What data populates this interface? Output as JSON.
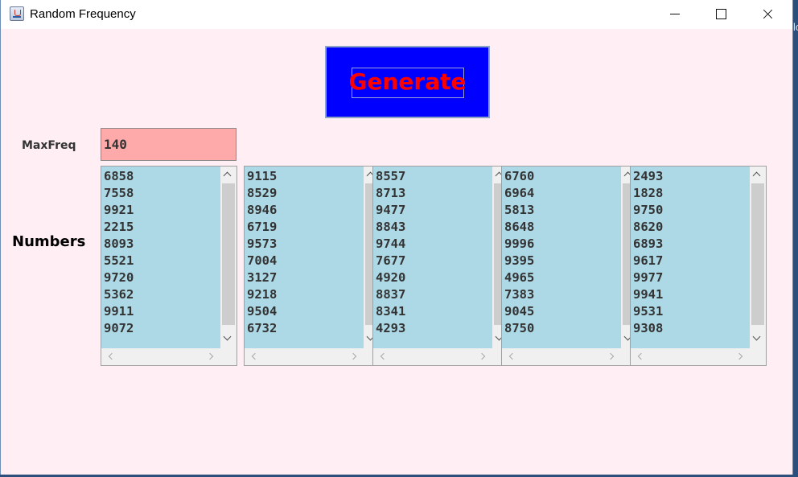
{
  "window": {
    "title": "Random Frequency"
  },
  "generate_button": {
    "label": "Generate",
    "bg_color": "#0000ff",
    "text_color": "#ff0000"
  },
  "maxfreq": {
    "label": "MaxFreq",
    "value": "140",
    "bg_color": "#ffaaaa"
  },
  "numbers": {
    "label": "Numbers",
    "bg_color": "#add8e6",
    "lists": [
      [
        "6858",
        "7558",
        "9921",
        "2215",
        "8093",
        "5521",
        "9720",
        "5362",
        "9911",
        "9072"
      ],
      [
        "9115",
        "8529",
        "8946",
        "6719",
        "9573",
        "7004",
        "3127",
        "9218",
        "9504",
        "6732"
      ],
      [
        "8557",
        "8713",
        "9477",
        "8843",
        "9744",
        "7677",
        "4920",
        "8837",
        "8341",
        "4293"
      ],
      [
        "6760",
        "6964",
        "5813",
        "8648",
        "9996",
        "9395",
        "4965",
        "7383",
        "9045",
        "8750"
      ],
      [
        "2493",
        "1828",
        "9750",
        "8620",
        "6893",
        "9617",
        "9977",
        "9941",
        "9531",
        "9308"
      ]
    ]
  },
  "background_peek": "lo",
  "icons": {
    "app": "java-cup-icon",
    "minimize": "minimize-icon",
    "maximize": "maximize-icon",
    "close": "close-icon"
  }
}
